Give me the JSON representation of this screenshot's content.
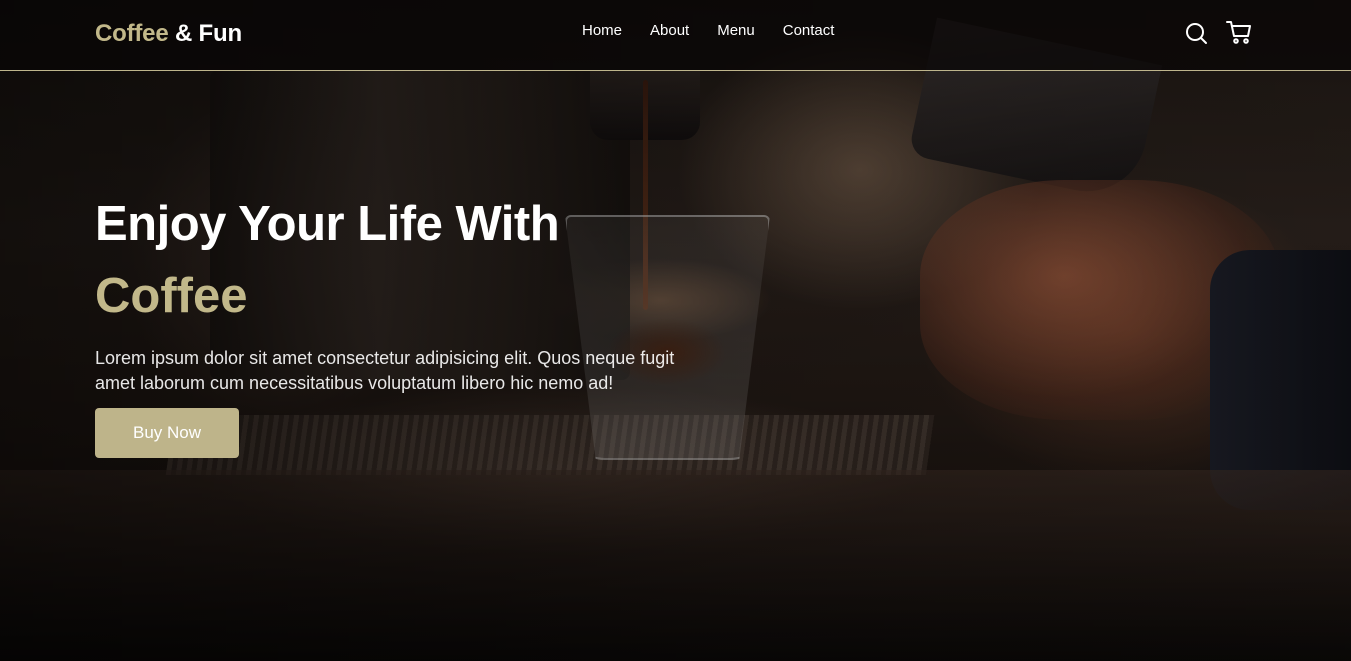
{
  "header": {
    "logo_accent": "Coffee",
    "logo_rest": " & Fun",
    "nav": [
      "Home",
      "About",
      "Menu",
      "Contact"
    ],
    "icons": [
      "search-icon",
      "cart-icon"
    ]
  },
  "hero": {
    "title": "Enjoy Your Life With",
    "highlight": "Coffee",
    "text": "Lorem ipsum dolor sit amet consectetur adipisicing elit. Quos neque fugit amet laborum cum necessitatibus voluptatum libero hic nemo ad!",
    "button_label": "Buy Now"
  },
  "colors": {
    "accent": "#c2b88a",
    "button": "#beb48a",
    "header_border": "#beb58c"
  }
}
